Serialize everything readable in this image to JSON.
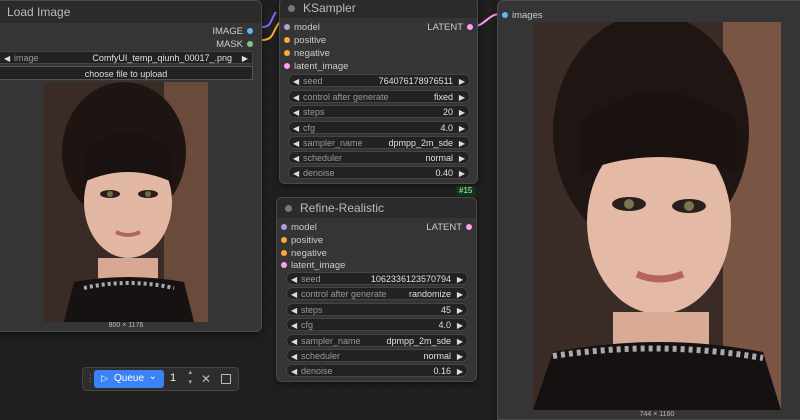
{
  "load_image": {
    "title": "Load Image",
    "out_image": "IMAGE",
    "out_mask": "MASK",
    "image_label": "image",
    "image_value": "ComfyUI_temp_qiunh_00017_.png",
    "upload_label": "choose file to upload",
    "dims": "800 × 1176"
  },
  "ksampler": {
    "title": "KSampler",
    "inputs": [
      "model",
      "positive",
      "negative",
      "latent_image"
    ],
    "output": "LATENT",
    "widgets": [
      {
        "label": "seed",
        "value": "764076178976511"
      },
      {
        "label": "control after generate",
        "value": "fixed"
      },
      {
        "label": "steps",
        "value": "20"
      },
      {
        "label": "cfg",
        "value": "4.0"
      },
      {
        "label": "sampler_name",
        "value": "dpmpp_2m_sde"
      },
      {
        "label": "scheduler",
        "value": "normal"
      },
      {
        "label": "denoise",
        "value": "0.40"
      }
    ],
    "badge": "#15"
  },
  "refine": {
    "title": "Refine-Realistic",
    "inputs": [
      "model",
      "positive",
      "negative",
      "latent_image"
    ],
    "output": "LATENT",
    "widgets": [
      {
        "label": "seed",
        "value": "1062336123570794"
      },
      {
        "label": "control after generate",
        "value": "randomize"
      },
      {
        "label": "steps",
        "value": "45"
      },
      {
        "label": "cfg",
        "value": "4.0"
      },
      {
        "label": "sampler_name",
        "value": "dpmpp_2m_sde"
      },
      {
        "label": "scheduler",
        "value": "normal"
      },
      {
        "label": "denoise",
        "value": "0.16"
      }
    ]
  },
  "preview": {
    "input_label": "images",
    "dims": "744 × 1160"
  },
  "queue": {
    "label": "Queue",
    "count": "1"
  },
  "colors": {
    "model": "#b39ddb",
    "conditioning": "#ffa931",
    "latent": "#ff9cf9",
    "image": "#64b5f6",
    "mask": "#81c784",
    "queue_button": "#3b82f6"
  },
  "icons": [
    "play-icon",
    "chevron-down-icon",
    "close-icon",
    "stop-icon",
    "drag-handle-icon",
    "left-arrow-icon",
    "right-arrow-icon"
  ]
}
